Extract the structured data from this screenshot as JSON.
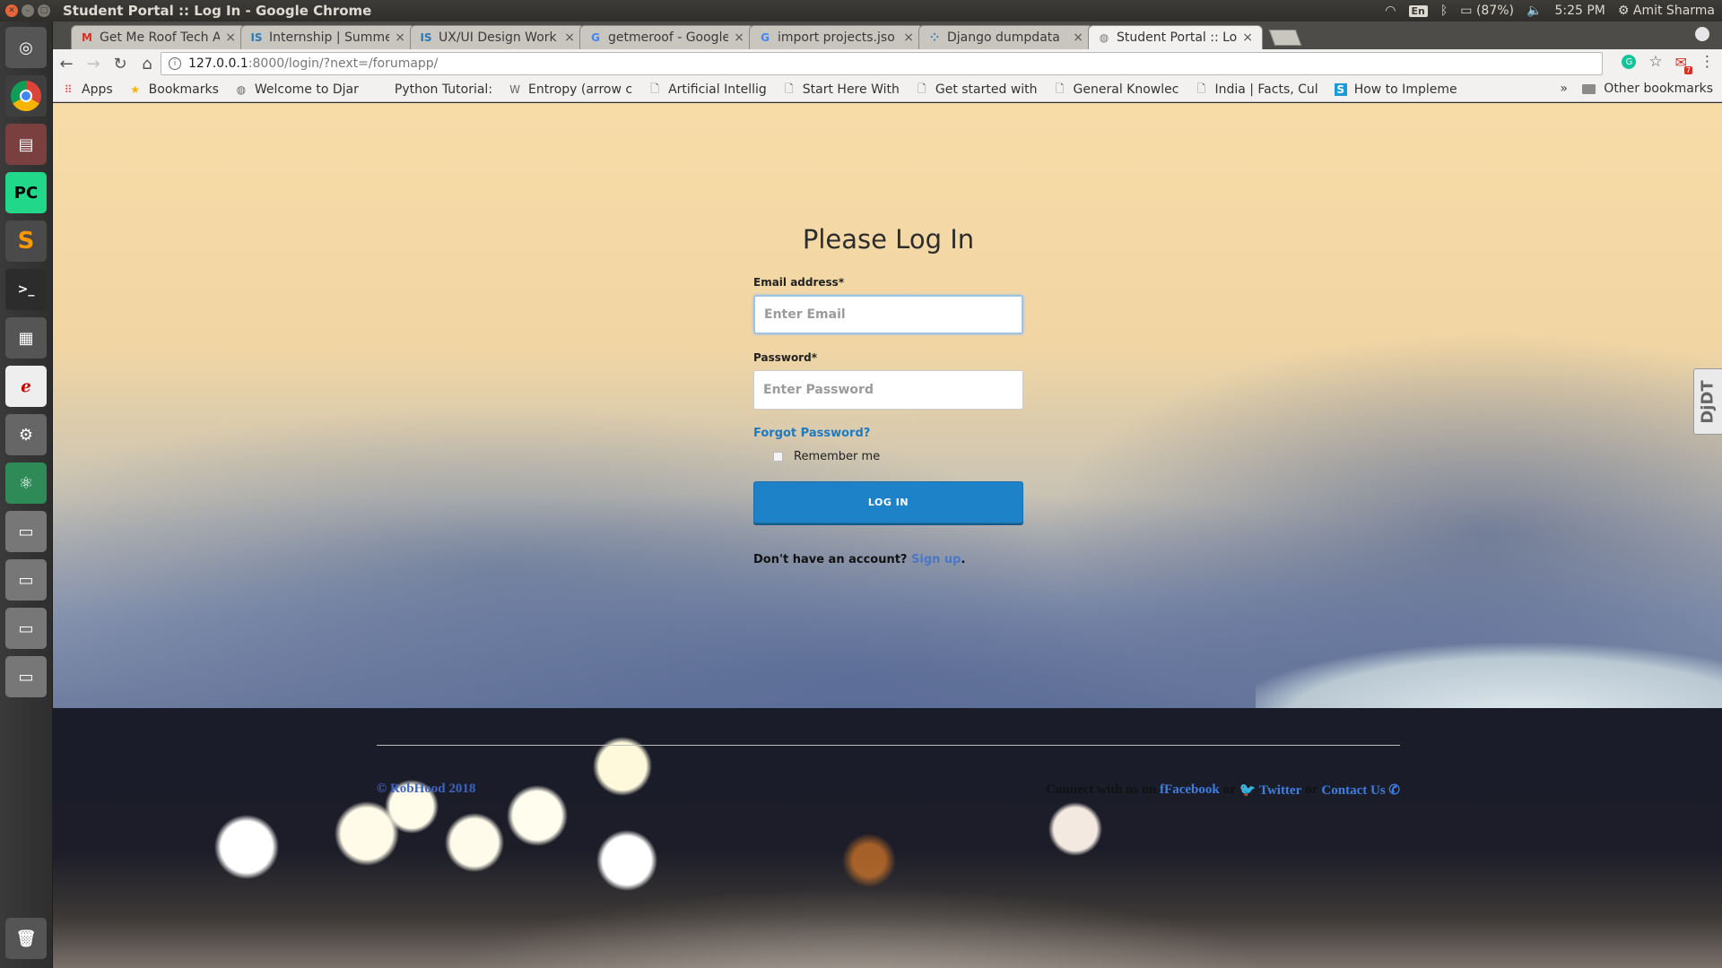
{
  "window": {
    "title": "Student Portal :: Log In - Google Chrome"
  },
  "system_tray": {
    "keyboard_layout": "En",
    "battery": "(87%)",
    "time": "5:25 PM",
    "user": "Amit Sharma"
  },
  "tabs": [
    {
      "label": "Get Me Roof Tech A",
      "icon": "gmail-icon",
      "icon_glyph": "M",
      "icon_color": "#d93025"
    },
    {
      "label": "Internship | Summe",
      "icon": "internshala-icon",
      "icon_glyph": "IS",
      "icon_color": "#2a7ab8"
    },
    {
      "label": "UX/UI Design Work",
      "icon": "internshala-icon",
      "icon_glyph": "IS",
      "icon_color": "#2a7ab8"
    },
    {
      "label": "getmeroof - Google",
      "icon": "google-icon",
      "icon_glyph": "G",
      "icon_color": "#4285f4"
    },
    {
      "label": "import projects.jso",
      "icon": "google-icon",
      "icon_glyph": "G",
      "icon_color": "#4285f4"
    },
    {
      "label": "Django dumpdata",
      "icon": "grid-icon",
      "icon_glyph": "⁘",
      "icon_color": "#2a7ab8"
    },
    {
      "label": "Student Portal :: Lo",
      "icon": "globe-icon",
      "icon_glyph": "◍",
      "icon_color": "#777777",
      "active": true
    }
  ],
  "toolbar": {
    "url_host": "127.0.0.1",
    "url_path": ":8000/login/?next=/forumapp/",
    "gmail_badge": "7"
  },
  "bookmarks": [
    {
      "label": "Apps",
      "icon": "apps-icon",
      "glyph": "⠿"
    },
    {
      "label": "Bookmarks",
      "icon": "star-icon",
      "glyph": "★"
    },
    {
      "label": "Welcome to Djar",
      "icon": "globe-icon",
      "glyph": "◍"
    },
    {
      "label": "Python Tutorial:",
      "icon": "python-icon",
      "glyph": ""
    },
    {
      "label": "Entropy (arrow c",
      "icon": "wikipedia-icon",
      "glyph": "W"
    },
    {
      "label": "Artificial Intellig",
      "icon": "page-icon",
      "glyph": "🗋"
    },
    {
      "label": "Start Here With",
      "icon": "page-icon",
      "glyph": "🗋"
    },
    {
      "label": "Get started with",
      "icon": "page-icon",
      "glyph": "🗋"
    },
    {
      "label": "General Knowlec",
      "icon": "page-icon",
      "glyph": "🗋"
    },
    {
      "label": "India | Facts, Cul",
      "icon": "page-icon",
      "glyph": "🗋"
    },
    {
      "label": "How to Impleme",
      "icon": "s-icon",
      "glyph": "S"
    }
  ],
  "bookmarks_more": "»",
  "bookmarks_other": "Other bookmarks",
  "login": {
    "heading": "Please Log In",
    "email_label": "Email address*",
    "email_placeholder": "Enter Email",
    "email_value": "",
    "password_label": "Password*",
    "password_placeholder": "Enter Password",
    "password_value": "",
    "forgot": "Forgot Password?",
    "remember": "Remember me",
    "submit": "LOG IN",
    "no_account": "Don't have an account?",
    "signup": "Sign up",
    "signup_suffix": "."
  },
  "ddt_tab": "DjDT",
  "footer": {
    "copyright": "© RobHood 2018",
    "connect": "Connect with us on",
    "facebook": "Facebook",
    "or1": "or",
    "twitter": "Twitter",
    "or2": "or",
    "contact": "Contact Us"
  },
  "colors": {
    "primary_button": "#1e82c8",
    "link": "#1d7bc2"
  }
}
